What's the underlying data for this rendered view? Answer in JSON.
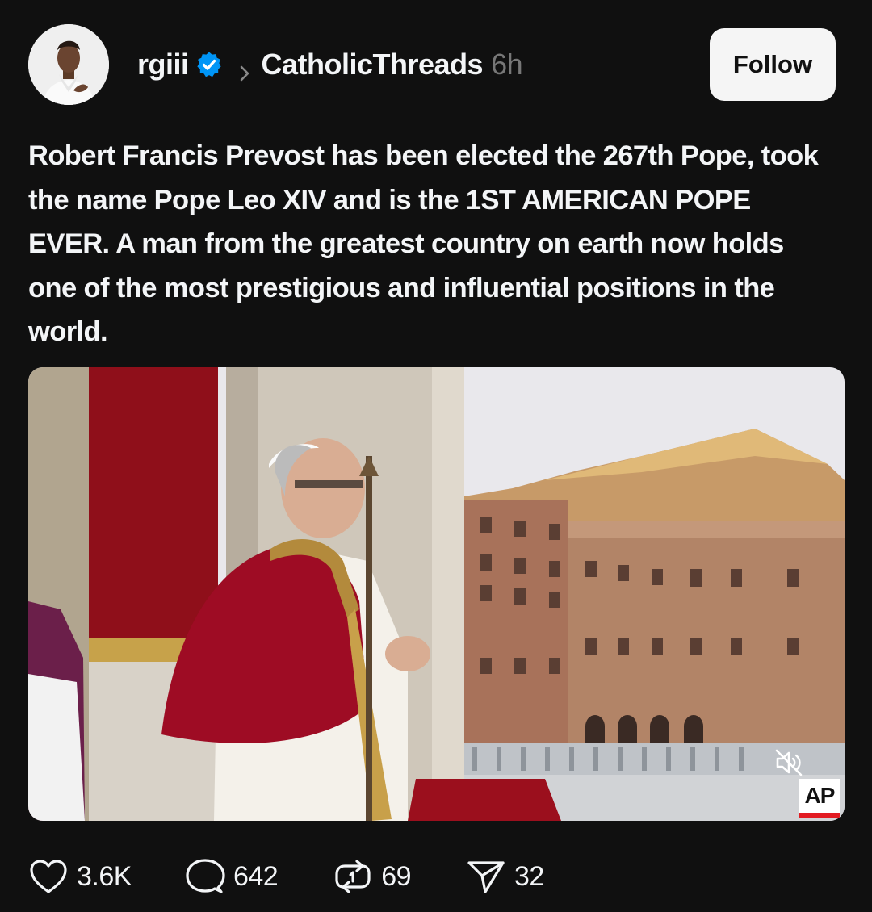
{
  "post": {
    "username": "rgiii",
    "community": "CatholicThreads",
    "time": "6h",
    "follow_label": "Follow",
    "text": "Robert Francis Prevost has been elected the 267th Pope, took the name Pope Leo XIV and is the 1ST AMERICAN POPE EVER. A man from the greatest country on earth now holds one of the most prestigious and influential positions in the world.",
    "media": {
      "watermark": "AP",
      "muted": true
    },
    "actions": {
      "likes": "3.6K",
      "replies": "642",
      "reposts": "69",
      "shares": "32"
    }
  },
  "colors": {
    "background": "#101010",
    "text": "#f3f5f7",
    "muted_text": "#777777",
    "verified_badge": "#0095f6",
    "follow_button_bg": "#f5f5f5"
  },
  "icons": {
    "verified": "verified-badge-icon",
    "separator": "chevron-right-icon",
    "like": "heart-icon",
    "reply": "speech-bubble-icon",
    "repost": "repost-icon",
    "share": "send-icon",
    "mute": "speaker-muted-icon"
  }
}
